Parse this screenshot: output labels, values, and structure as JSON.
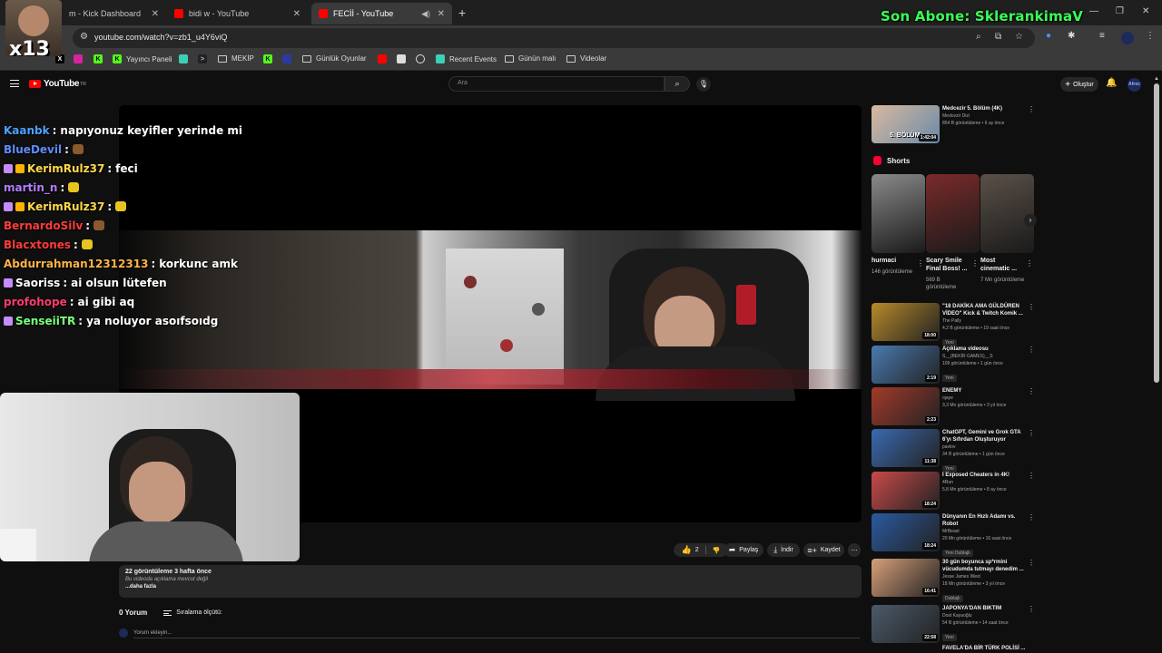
{
  "browser": {
    "tabs": [
      {
        "label": "m - Kick Dashboard",
        "fav_color": "#53fc18"
      },
      {
        "label": "bidi w - YouTube",
        "fav_color": "#ff0000"
      },
      {
        "label": "FECİİ - YouTube",
        "fav_color": "#ff0000"
      }
    ],
    "url": "youtube.com/watch?v=zb1_u4Y6viQ",
    "bookmarks": [
      {
        "label": "Yayıncı Paneli",
        "icon": "kick-icon"
      },
      {
        "label": "MEKİP",
        "icon": "folder-icon"
      },
      {
        "label": "Günlük Oyunlar",
        "icon": "folder-icon"
      },
      {
        "label": "Recent Events",
        "icon": "kick-icon"
      },
      {
        "label": "Günün malı",
        "icon": "folder-icon"
      },
      {
        "label": "Videolar",
        "icon": "folder-icon"
      }
    ]
  },
  "overlay": {
    "banner": "Son Abone: SklerankimaV",
    "multiplier": "x13"
  },
  "youtube": {
    "logo": "YouTube",
    "logo_region": "TR",
    "search_placeholder": "Ara",
    "create_label": "Oluştur",
    "account_initials": "Afroc"
  },
  "chat": [
    {
      "user": "Kaanbk",
      "color": "#4ea1ff",
      "message": "napıyonuz keyifler yerinde mi",
      "badges": 0,
      "emote": ""
    },
    {
      "user": "BlueDevil",
      "color": "#5f8cff",
      "message": "",
      "badges": 0,
      "emote": "#8a5a2e"
    },
    {
      "user": "KerimRulz37",
      "color": "#ffd84a",
      "message": "feci",
      "badges": 2,
      "emote": ""
    },
    {
      "user": "martin_n",
      "color": "#b47cff",
      "message": "",
      "badges": 0,
      "emote": "#e7c51f"
    },
    {
      "user": "KerimRulz37",
      "color": "#ffd84a",
      "message": "",
      "badges": 2,
      "emote": "#e7c51f"
    },
    {
      "user": "BernardoSilv",
      "color": "#ff3b3b",
      "message": "",
      "badges": 0,
      "emote": "#8a5a2e"
    },
    {
      "user": "Blacxtones",
      "color": "#ff3b3b",
      "message": "",
      "badges": 0,
      "emote": "#e7c51f"
    },
    {
      "user": "Abdurrahman12312313",
      "color": "#ffb347",
      "message": "korkunc amk",
      "badges": 0,
      "emote": ""
    },
    {
      "user": "Saoriss",
      "color": "#ffffff",
      "message": "ai olsun lütefen",
      "badges": 1,
      "emote": ""
    },
    {
      "user": "profohope",
      "color": "#ff3b6b",
      "message": "ai gibi aq",
      "badges": 0,
      "emote": ""
    },
    {
      "user": "SenseiiTR",
      "color": "#7cff7c",
      "message": "ya noluyor asоıfsоıdg",
      "badges": 1,
      "emote": ""
    }
  ],
  "actions": {
    "likes": "2",
    "share": "Paylaş",
    "download": "İndir",
    "save": "Kaydet"
  },
  "description": {
    "views_date": "22 görüntüleme  3 hafta önce",
    "no_desc": "Bu videoda açıklama mevcut değil",
    "more": "...daha fazla"
  },
  "comments": {
    "count": "0 Yorum",
    "sort": "Sıralama ölçütü:",
    "placeholder": "Yorum ekleyin..."
  },
  "sidebar": {
    "top_video": {
      "title": "Medcezir 5. Bölüm (4K)",
      "channel": "Medcezir Dizi",
      "meta": "854 B görüntüleme • 6 ay önce",
      "duration": "1:42:04",
      "overlay": "5. BÖLÜM"
    },
    "shorts_label": "Shorts",
    "shorts": [
      {
        "title": "hurmaci",
        "meta": "146 görüntüleme",
        "color": "#8a8a8a"
      },
      {
        "title": "Scary Smile Final Boss! ...",
        "meta": "569 B görüntüleme",
        "color": "#7a2a2a"
      },
      {
        "title": "Most cinematic ...",
        "meta": "7 Mn görüntüleme",
        "color": "#5a5048"
      }
    ],
    "videos": [
      {
        "title": "\"18 DAKİKA AMA GÜLDÜREN VİDEO\" Kick & Twitch Komik ...",
        "channel": "The Pally",
        "meta": "4,2 B görüntüleme • 19 saat önce",
        "badge": "Yeni",
        "duration": "18:00",
        "color": "#b88a2a"
      },
      {
        "title": "Açıklama videosu",
        "channel": "S__(BEKİR GAMES)__S",
        "meta": "109 görüntüleme • 1 gün önce",
        "badge": "Yeni",
        "duration": "2:19",
        "color": "#4a7ab0"
      },
      {
        "title": "ENEMY",
        "channel": "ojaye",
        "meta": "3,3 Mn görüntüleme • 3 yıl önce",
        "badge": "",
        "duration": "2:23",
        "color": "#a33a2a"
      },
      {
        "title": "ChatGPT, Gemini ve Grok GTA 6'yı Sıfırdan Oluşturuyor",
        "channel": "pavlov",
        "meta": "34 B görüntüleme • 1 gün önce",
        "badge": "Yeni",
        "duration": "11:38",
        "color": "#3a6ab0"
      },
      {
        "title": "I Exposed Cheaters in 4K!",
        "channel": "4Run",
        "meta": "5,8 Mn görüntüleme • 8 ay önce",
        "badge": "",
        "duration": "18:24",
        "color": "#c94a4a"
      },
      {
        "title": "Dünyanın En Hızlı Adamı vs. Robot",
        "channel": "MrBeast",
        "meta": "20 Mn görüntüleme • 16 saat önce",
        "badge": "Yeni  Dublajlı",
        "duration": "18:24",
        "color": "#2a5aa0"
      },
      {
        "title": "30 gün boyunca sp*rmini vücudumda tutmayı denedim ...",
        "channel": "Jesse James West",
        "meta": "18 Mn görüntüleme • 3 yıl önce",
        "badge": "Dublajlı",
        "duration": "16:41",
        "color": "#d8a07a"
      },
      {
        "title": "JAPONYA'DAN BIKTIM",
        "channel": "Dost Kayaoğlu",
        "meta": "54 B görüntüleme • 14 saat önce",
        "badge": "Yeni",
        "duration": "22:58",
        "color": "#4a5a6a"
      }
    ],
    "cut_title": "FAVELA'DA BİR TÜRK POLİSİ ..."
  }
}
